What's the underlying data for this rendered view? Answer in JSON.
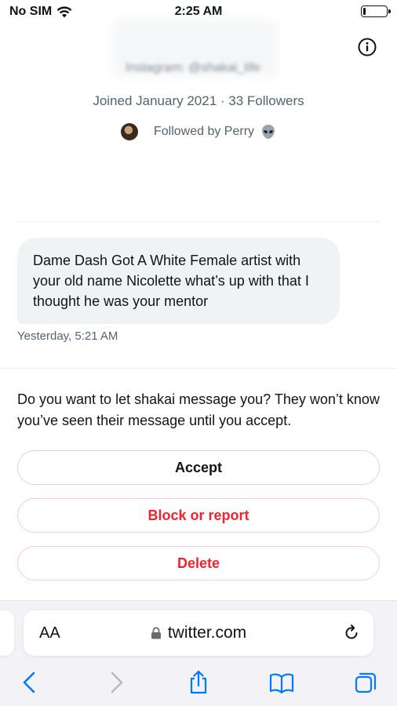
{
  "status_bar": {
    "carrier": "No SIM",
    "time": "2:25 AM",
    "battery_level": 0.12
  },
  "profile": {
    "bio_partial": "Instagram: @shakai_life",
    "joined": "Joined January 2021 · 33 Followers",
    "followed_by": "Followed by Perry",
    "followed_by_emoji": "alien-icon"
  },
  "message": {
    "text": "Dame Dash Got A White Female artist with your old name Nicolette what’s up with that I thought he was your mentor",
    "timestamp": "Yesterday, 5:21 AM"
  },
  "request": {
    "prompt": "Do you want to let shakai message you? They won’t know you’ve seen their message until you accept.",
    "accept_label": "Accept",
    "block_label": "Block or report",
    "delete_label": "Delete"
  },
  "browser": {
    "text_size_label": "AA",
    "url": "twitter.com"
  },
  "colors": {
    "accent_red": "#f4212e",
    "secondary_text": "#536471",
    "bubble_bg": "#eff3f4",
    "safari_blue": "#007aff"
  }
}
